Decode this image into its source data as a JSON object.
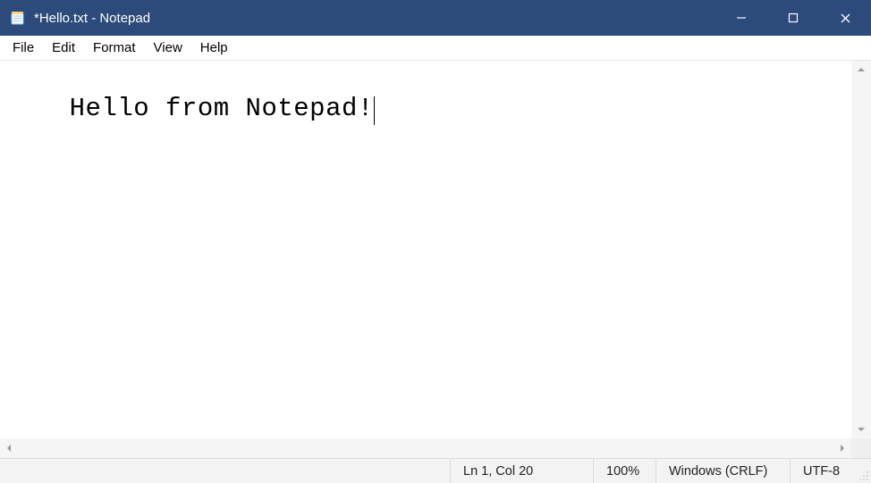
{
  "titlebar": {
    "title": "*Hello.txt - Notepad"
  },
  "menu": {
    "items": [
      "File",
      "Edit",
      "Format",
      "View",
      "Help"
    ]
  },
  "editor": {
    "content": "Hello from Notepad!"
  },
  "statusbar": {
    "position": "Ln 1, Col 20",
    "zoom": "100%",
    "line_ending": "Windows (CRLF)",
    "encoding": "UTF-8"
  }
}
